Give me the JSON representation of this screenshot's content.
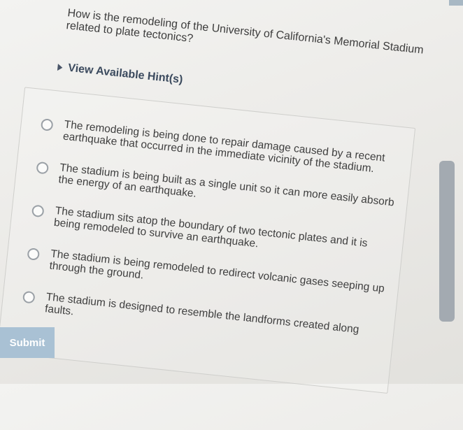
{
  "question": {
    "text": "How is the remodeling of the University of California's Memorial Stadium related to plate tectonics?"
  },
  "hint": {
    "label": "View Available Hint(s)"
  },
  "options": [
    {
      "text": "The remodeling is being done to repair damage caused by a recent earthquake that occurred in the immediate vicinity of the stadium."
    },
    {
      "text": "The stadium is being built as a single unit so it can more easily absorb the energy of an earthquake."
    },
    {
      "text": "The stadium sits atop the boundary of two tectonic plates and it is being remodeled to survive an earthquake."
    },
    {
      "text": "The stadium is being remodeled to redirect volcanic gases seeping up through the ground."
    },
    {
      "text": "The stadium is designed to resemble the landforms created along faults."
    }
  ],
  "submit": {
    "label": "Submit"
  },
  "colors": {
    "submit_bg": "#a9c1d4",
    "hint_text": "#3b4a5e",
    "scrollbar": "#a3aab1"
  }
}
